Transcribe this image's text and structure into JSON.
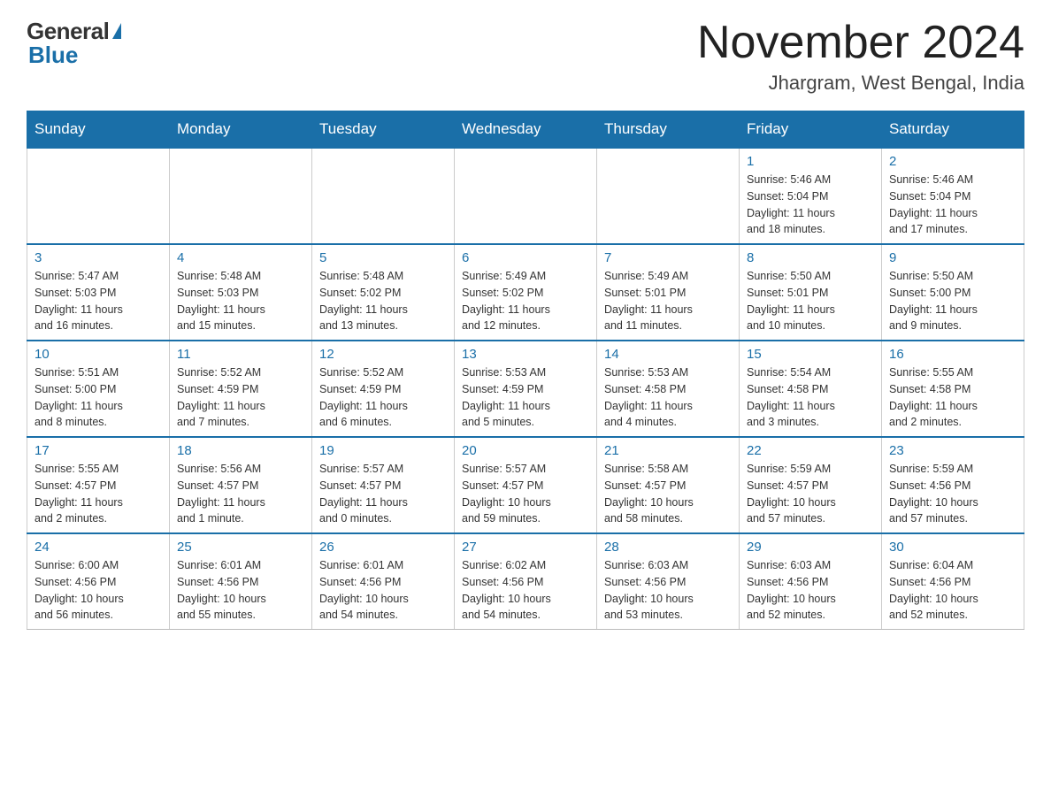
{
  "header": {
    "logo_general": "General",
    "logo_blue": "Blue",
    "month_title": "November 2024",
    "location": "Jhargram, West Bengal, India"
  },
  "weekdays": [
    "Sunday",
    "Monday",
    "Tuesday",
    "Wednesday",
    "Thursday",
    "Friday",
    "Saturday"
  ],
  "weeks": [
    [
      {
        "day": "",
        "info": ""
      },
      {
        "day": "",
        "info": ""
      },
      {
        "day": "",
        "info": ""
      },
      {
        "day": "",
        "info": ""
      },
      {
        "day": "",
        "info": ""
      },
      {
        "day": "1",
        "info": "Sunrise: 5:46 AM\nSunset: 5:04 PM\nDaylight: 11 hours\nand 18 minutes."
      },
      {
        "day": "2",
        "info": "Sunrise: 5:46 AM\nSunset: 5:04 PM\nDaylight: 11 hours\nand 17 minutes."
      }
    ],
    [
      {
        "day": "3",
        "info": "Sunrise: 5:47 AM\nSunset: 5:03 PM\nDaylight: 11 hours\nand 16 minutes."
      },
      {
        "day": "4",
        "info": "Sunrise: 5:48 AM\nSunset: 5:03 PM\nDaylight: 11 hours\nand 15 minutes."
      },
      {
        "day": "5",
        "info": "Sunrise: 5:48 AM\nSunset: 5:02 PM\nDaylight: 11 hours\nand 13 minutes."
      },
      {
        "day": "6",
        "info": "Sunrise: 5:49 AM\nSunset: 5:02 PM\nDaylight: 11 hours\nand 12 minutes."
      },
      {
        "day": "7",
        "info": "Sunrise: 5:49 AM\nSunset: 5:01 PM\nDaylight: 11 hours\nand 11 minutes."
      },
      {
        "day": "8",
        "info": "Sunrise: 5:50 AM\nSunset: 5:01 PM\nDaylight: 11 hours\nand 10 minutes."
      },
      {
        "day": "9",
        "info": "Sunrise: 5:50 AM\nSunset: 5:00 PM\nDaylight: 11 hours\nand 9 minutes."
      }
    ],
    [
      {
        "day": "10",
        "info": "Sunrise: 5:51 AM\nSunset: 5:00 PM\nDaylight: 11 hours\nand 8 minutes."
      },
      {
        "day": "11",
        "info": "Sunrise: 5:52 AM\nSunset: 4:59 PM\nDaylight: 11 hours\nand 7 minutes."
      },
      {
        "day": "12",
        "info": "Sunrise: 5:52 AM\nSunset: 4:59 PM\nDaylight: 11 hours\nand 6 minutes."
      },
      {
        "day": "13",
        "info": "Sunrise: 5:53 AM\nSunset: 4:59 PM\nDaylight: 11 hours\nand 5 minutes."
      },
      {
        "day": "14",
        "info": "Sunrise: 5:53 AM\nSunset: 4:58 PM\nDaylight: 11 hours\nand 4 minutes."
      },
      {
        "day": "15",
        "info": "Sunrise: 5:54 AM\nSunset: 4:58 PM\nDaylight: 11 hours\nand 3 minutes."
      },
      {
        "day": "16",
        "info": "Sunrise: 5:55 AM\nSunset: 4:58 PM\nDaylight: 11 hours\nand 2 minutes."
      }
    ],
    [
      {
        "day": "17",
        "info": "Sunrise: 5:55 AM\nSunset: 4:57 PM\nDaylight: 11 hours\nand 2 minutes."
      },
      {
        "day": "18",
        "info": "Sunrise: 5:56 AM\nSunset: 4:57 PM\nDaylight: 11 hours\nand 1 minute."
      },
      {
        "day": "19",
        "info": "Sunrise: 5:57 AM\nSunset: 4:57 PM\nDaylight: 11 hours\nand 0 minutes."
      },
      {
        "day": "20",
        "info": "Sunrise: 5:57 AM\nSunset: 4:57 PM\nDaylight: 10 hours\nand 59 minutes."
      },
      {
        "day": "21",
        "info": "Sunrise: 5:58 AM\nSunset: 4:57 PM\nDaylight: 10 hours\nand 58 minutes."
      },
      {
        "day": "22",
        "info": "Sunrise: 5:59 AM\nSunset: 4:57 PM\nDaylight: 10 hours\nand 57 minutes."
      },
      {
        "day": "23",
        "info": "Sunrise: 5:59 AM\nSunset: 4:56 PM\nDaylight: 10 hours\nand 57 minutes."
      }
    ],
    [
      {
        "day": "24",
        "info": "Sunrise: 6:00 AM\nSunset: 4:56 PM\nDaylight: 10 hours\nand 56 minutes."
      },
      {
        "day": "25",
        "info": "Sunrise: 6:01 AM\nSunset: 4:56 PM\nDaylight: 10 hours\nand 55 minutes."
      },
      {
        "day": "26",
        "info": "Sunrise: 6:01 AM\nSunset: 4:56 PM\nDaylight: 10 hours\nand 54 minutes."
      },
      {
        "day": "27",
        "info": "Sunrise: 6:02 AM\nSunset: 4:56 PM\nDaylight: 10 hours\nand 54 minutes."
      },
      {
        "day": "28",
        "info": "Sunrise: 6:03 AM\nSunset: 4:56 PM\nDaylight: 10 hours\nand 53 minutes."
      },
      {
        "day": "29",
        "info": "Sunrise: 6:03 AM\nSunset: 4:56 PM\nDaylight: 10 hours\nand 52 minutes."
      },
      {
        "day": "30",
        "info": "Sunrise: 6:04 AM\nSunset: 4:56 PM\nDaylight: 10 hours\nand 52 minutes."
      }
    ]
  ]
}
